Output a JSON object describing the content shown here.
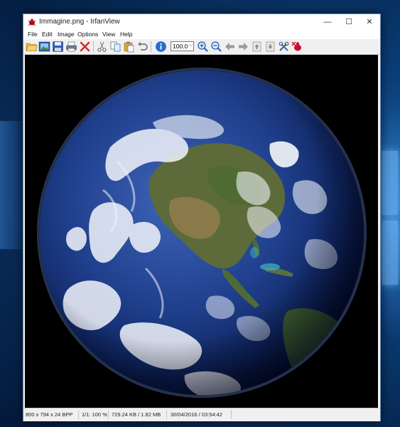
{
  "window": {
    "title": "Immagine.png - IrfanView",
    "controls": {
      "minimize": "—",
      "maximize": "☐",
      "close": "✕"
    }
  },
  "menu": [
    "File",
    "Edit",
    "Image",
    "Options",
    "View",
    "Help"
  ],
  "toolbar": {
    "zoom_value": "100.0",
    "icons": [
      "open-folder-icon",
      "thumbnails-icon",
      "save-icon",
      "print-icon",
      "delete-icon",
      "cut-icon",
      "copy-icon",
      "paste-icon",
      "undo-icon",
      "info-icon",
      "zoom-in-icon",
      "zoom-out-icon",
      "previous-icon",
      "next-icon",
      "first-page-icon",
      "last-page-icon",
      "settings-icon",
      "exit-icon"
    ]
  },
  "status": {
    "dimensions": "800 x 794 x 24 BPP",
    "zoom": "1/1: 100 %",
    "filesize": "729.24 KB / 1.82 MB",
    "datetime": "30/04/2016 / 03:54:42"
  },
  "colors": {
    "accent": "#0078d7",
    "desktop": "#0b3f7a",
    "titlebar": "#ffffff",
    "close_red": "#d62b2b"
  }
}
